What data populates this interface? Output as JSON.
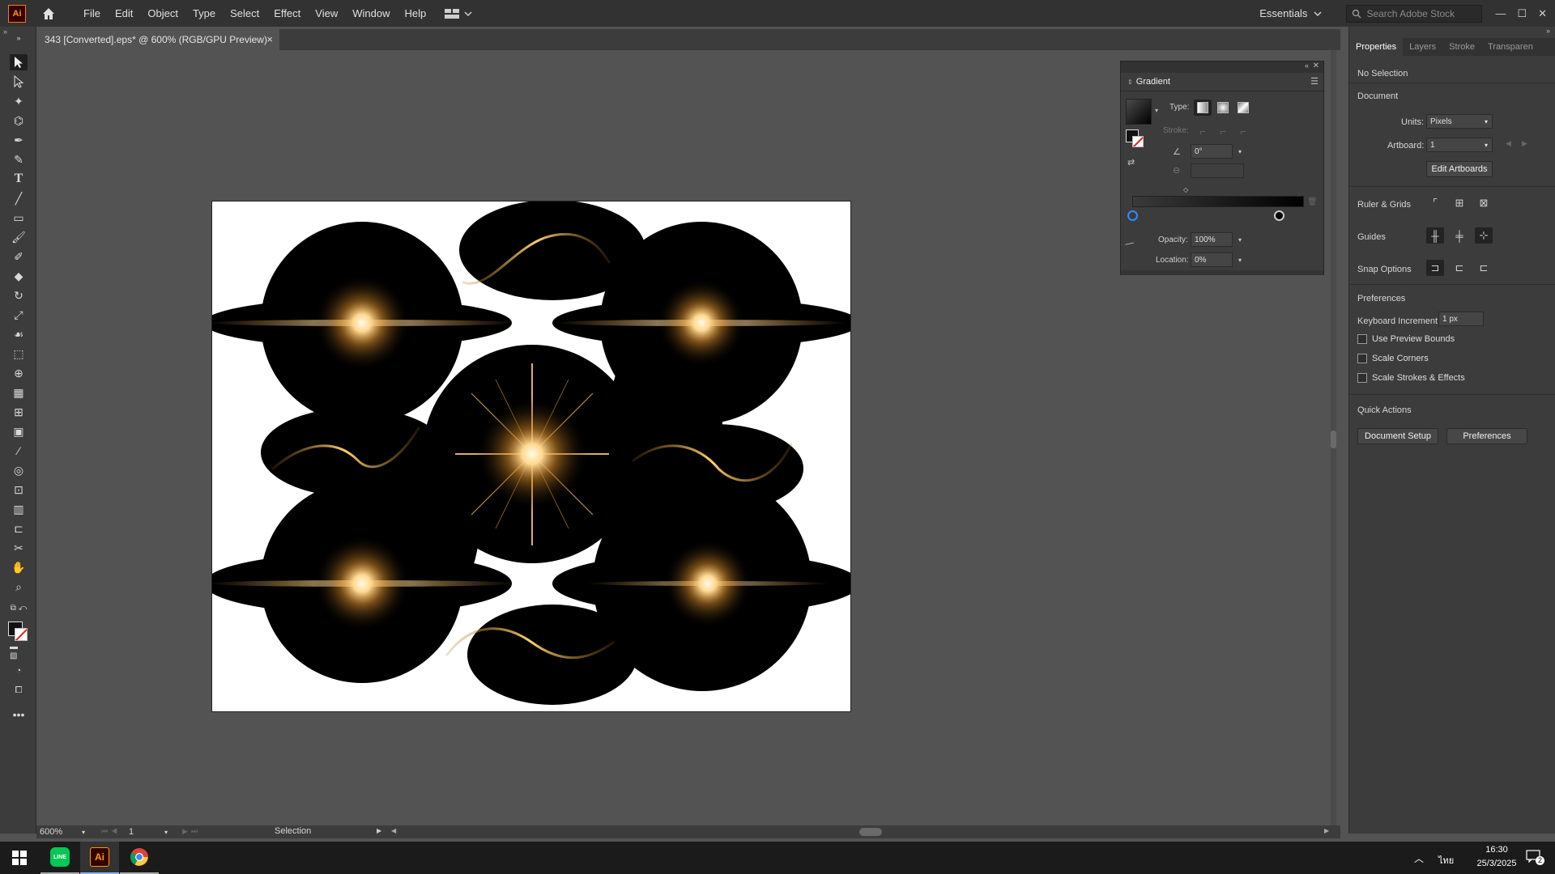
{
  "app": {
    "logo_text": "Ai",
    "menus": [
      "File",
      "Edit",
      "Object",
      "Type",
      "Select",
      "Effect",
      "View",
      "Window",
      "Help"
    ],
    "workspace_label": "Essentials",
    "search_placeholder": "Search Adobe Stock"
  },
  "document_tab": {
    "title": "343 [Converted].eps* @ 600% (RGB/GPU Preview)",
    "close_glyph": "×"
  },
  "gradient_panel": {
    "tab_label": "Gradient",
    "type_label": "Type:",
    "stroke_label": "Stroke:",
    "angle_value": "0°",
    "opacity_label": "Opacity:",
    "opacity_value": "100%",
    "location_label": "Location:",
    "location_value": "0%"
  },
  "properties": {
    "tabs": [
      "Properties",
      "Layers",
      "Stroke",
      "Transparen"
    ],
    "selection_status": "No Selection",
    "document_section": "Document",
    "units_label": "Units:",
    "units_value": "Pixels",
    "artboard_label": "Artboard:",
    "artboard_value": "1",
    "edit_artboards": "Edit Artboards",
    "ruler_grids": "Ruler & Grids",
    "guides": "Guides",
    "snap_options": "Snap Options",
    "preferences_section": "Preferences",
    "keyboard_increment_label": "Keyboard Increment:",
    "keyboard_increment_value": "1 px",
    "checkboxes": [
      "Use Preview Bounds",
      "Scale Corners",
      "Scale Strokes & Effects"
    ],
    "quick_actions": "Quick Actions",
    "document_setup_button": "Document Setup",
    "preferences_button": "Preferences"
  },
  "status_bar": {
    "zoom": "600%",
    "artboard_num": "1",
    "tool_status": "Selection"
  },
  "taskbar": {
    "time": "16:30",
    "date": "25/3/2025",
    "lang": "ไทย",
    "notif_count": "2",
    "ai_label": "Ai"
  },
  "colors": {
    "accent_blue": "#2b8cff",
    "ai_orange": "#ff9a00",
    "panel_bg": "#3c3c3c",
    "canvas_bg": "#535353"
  }
}
